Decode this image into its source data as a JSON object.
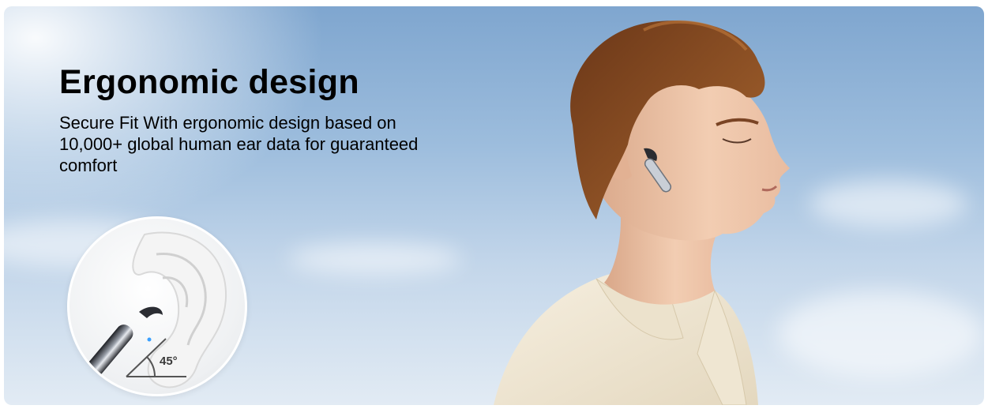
{
  "banner": {
    "headline": "Ergonomic design",
    "subtext": "Secure Fit With ergonomic design based on 10,000+ global human ear data for guaranteed comfort",
    "inset": {
      "angle_label": "45°"
    },
    "colors": {
      "sky_top": "#7fa6cf",
      "sky_bottom": "#e2ebf4",
      "shirt": "#f1e8d4",
      "hair": "#8a4e24",
      "skin": "#f0c9ad"
    },
    "icons": [
      "ear-with-earbud-icon",
      "angle-indicator-icon",
      "earbud-icon"
    ]
  }
}
